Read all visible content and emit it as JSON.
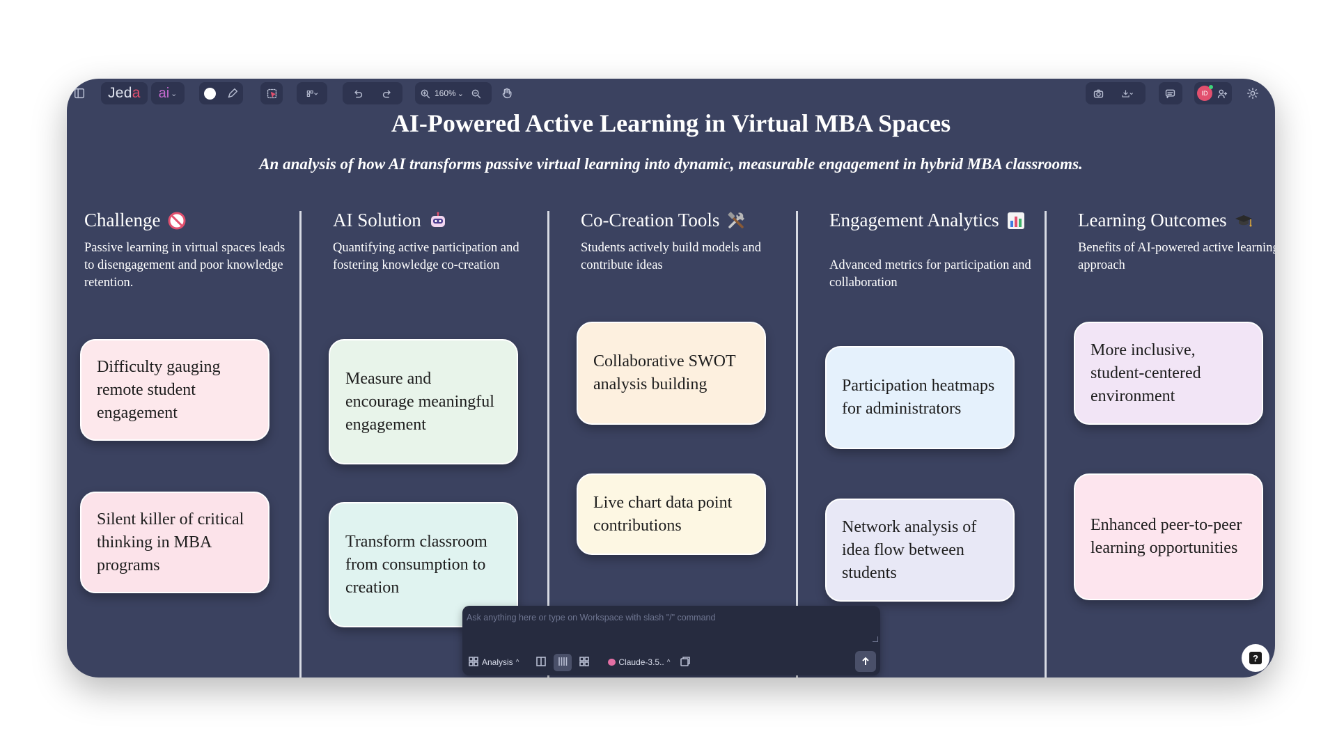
{
  "app": {
    "logo_prefix": "Jed",
    "logo_accent": "a",
    "ai_label": "ai",
    "zoom_level": "160%",
    "avatar_initials": "ID"
  },
  "board": {
    "title": "AI-Powered Active Learning in Virtual MBA Spaces",
    "subtitle": "An analysis of how AI transforms passive virtual learning into dynamic, measurable engagement in hybrid MBA classrooms."
  },
  "columns": [
    {
      "heading": "Challenge",
      "icon": "prohibited-icon",
      "description": "Passive learning in virtual spaces leads to disengagement and poor knowledge retention.",
      "cards": [
        {
          "text": "Difficulty gauging remote student engagement",
          "color": "#fde8ec"
        },
        {
          "text": "Silent killer of critical thinking in MBA programs",
          "color": "#fce3ea"
        }
      ]
    },
    {
      "heading": "AI Solution",
      "icon": "robot-icon",
      "description": "Quantifying active participation and fostering knowledge co-creation",
      "cards": [
        {
          "text": "Measure and encourage meaningful engagement",
          "color": "#e8f4ea"
        },
        {
          "text": "Transform classroom from consumption to creation",
          "color": "#e0f3f0"
        }
      ]
    },
    {
      "heading": "Co-Creation Tools",
      "icon": "tools-icon",
      "description": "Students actively build models and contribute ideas",
      "cards": [
        {
          "text": "Collaborative SWOT analysis building",
          "color": "#fdf0df"
        },
        {
          "text": "Live chart data point contributions",
          "color": "#fdf7e3"
        }
      ]
    },
    {
      "heading": "Engagement Analytics",
      "icon": "bar-chart-icon",
      "description": "Advanced metrics for participation and collaboration",
      "cards": [
        {
          "text": "Participation heatmaps for administrators",
          "color": "#e5f1fc"
        },
        {
          "text": "Network analysis of idea flow between students",
          "color": "#e8e8f6"
        }
      ]
    },
    {
      "heading": "Learning Outcomes",
      "icon": "graduation-cap-icon",
      "description": "Benefits of AI-powered active learning approach",
      "cards": [
        {
          "text": "More inclusive, student-centered environment",
          "color": "#f2e5f6"
        },
        {
          "text": "Enhanced peer-to-peer learning opportunities",
          "color": "#fde5ee"
        }
      ]
    }
  ],
  "chat": {
    "placeholder": "Ask anything here or type on Workspace with slash \"/\" command",
    "mode_label": "Analysis",
    "model_label": "Claude-3.5.."
  },
  "help_label": "?"
}
